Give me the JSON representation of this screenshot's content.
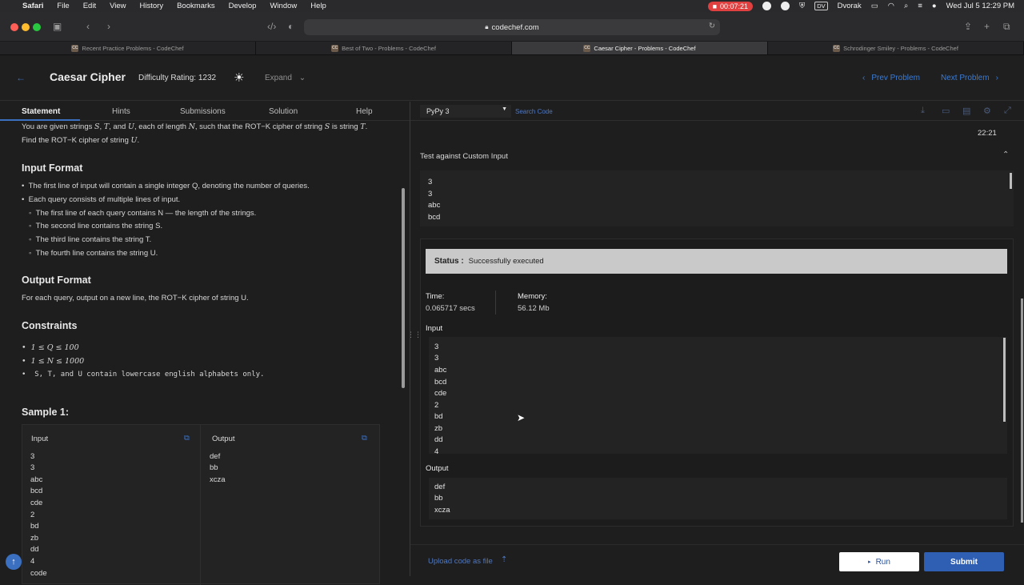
{
  "menubar": {
    "items": [
      "Safari",
      "File",
      "Edit",
      "View",
      "History",
      "Bookmarks",
      "Develop",
      "Window",
      "Help"
    ],
    "recording_time": "00:07:21",
    "input_source": "Dvorak",
    "input_badge": "DV",
    "datetime": "Wed Jul 5  12:29 PM"
  },
  "browser": {
    "url": "codechef.com",
    "tabs": [
      {
        "label": "Recent Practice Problems - CodeChef",
        "active": false
      },
      {
        "label": "Best of Two - Problems - CodeChef",
        "active": false
      },
      {
        "label": "Caesar Cipher - Problems - CodeChef",
        "active": true
      },
      {
        "label": "Schrodinger Smiley - Problems - CodeChef",
        "active": false
      }
    ],
    "favicon": "CC"
  },
  "header": {
    "title": "Caesar Cipher",
    "difficulty": "Difficulty Rating: 1232",
    "expand": "Expand",
    "prev": "Prev Problem",
    "next": "Next Problem"
  },
  "left_tabs": [
    "Statement",
    "Hints",
    "Submissions",
    "Solution",
    "Help"
  ],
  "statement": {
    "intro_1": "You are given strings",
    "intro_2": ", each of length",
    "intro_3": ", such that the ROT−K cipher of string",
    "intro_4": "is string",
    "intro_5": "Find the ROT−K cipher of string",
    "vars": {
      "S": "S",
      "T": "T",
      "U": "U",
      "N": "N",
      "Q": "Q"
    },
    "input_format_title": "Input Format",
    "input_bullets": [
      "The first line of input will contain a single integer Q, denoting the number of queries.",
      "Each query consists of multiple lines of input."
    ],
    "input_sub_bullets": [
      "The first line of each query contains N — the length of the strings.",
      "The second line contains the string S.",
      "The third line contains the string T.",
      "The fourth line contains the string U."
    ],
    "output_format_title": "Output Format",
    "output_text": "For each query, output on a new line, the ROT−K cipher of string U.",
    "constraints_title": "Constraints",
    "constraints": [
      "1 ≤ Q ≤ 100",
      "1 ≤ N ≤ 1000",
      "S, T, and U contain lowercase english alphabets only."
    ],
    "sample_title": "Sample 1:",
    "sample_input_label": "Input",
    "sample_output_label": "Output",
    "sample_input": [
      "3",
      "3",
      "abc",
      "bcd",
      "cde",
      "2",
      "bd",
      "zb",
      "dd",
      "4",
      "code"
    ],
    "sample_output": [
      "def",
      "bb",
      "xcza"
    ]
  },
  "editor": {
    "language": "PyPy 3",
    "search_placeholder": "Search Code",
    "timer": "22:21",
    "custom_input_label": "Test against Custom Input",
    "custom_input_lines": [
      "3",
      "3",
      "abc",
      "bcd"
    ],
    "status_label": "Status :",
    "status_value": "Successfully executed",
    "time_label": "Time:",
    "time_value": "0.065717 secs",
    "memory_label": "Memory:",
    "memory_value": "56.12 Mb",
    "input_label": "Input",
    "input_lines": [
      "3",
      "3",
      "abc",
      "bcd",
      "cde",
      "2",
      "bd",
      "zb",
      "dd",
      "4"
    ],
    "output_label": "Output",
    "output_lines": [
      "def",
      "bb",
      "xcza"
    ],
    "upload_label": "Upload code as file",
    "run_label": "Run",
    "submit_label": "Submit"
  },
  "colors": {
    "accent": "#3b6fbf",
    "submit": "#2f5fb3",
    "status_bar": "#c9c9c9",
    "background": "#1e1e1e"
  }
}
